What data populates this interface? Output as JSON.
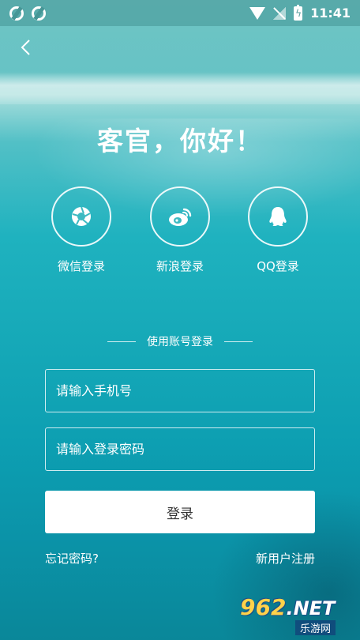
{
  "status_bar": {
    "time": "11:41",
    "left_icons": [
      "app-icon",
      "app-icon"
    ],
    "right_icons": [
      "wifi-icon",
      "no-signal-icon",
      "battery-charging-icon"
    ]
  },
  "header": {
    "back_icon": "chevron-left-icon"
  },
  "greeting": "客官，你好！",
  "social_logins": [
    {
      "label": "微信登录",
      "icon": "wechat-shutter-icon"
    },
    {
      "label": "新浪登录",
      "icon": "weibo-icon"
    },
    {
      "label": "QQ登录",
      "icon": "qq-penguin-icon"
    }
  ],
  "divider_text": "使用账号登录",
  "form": {
    "phone_placeholder": "请输入手机号",
    "password_placeholder": "请输入登录密码",
    "login_label": "登录",
    "forgot_label": "忘记密码?",
    "register_label": "新用户注册"
  },
  "watermark": {
    "number": "962",
    "domain": ".NET",
    "sub": "乐游网"
  },
  "colors": {
    "water_top": "#67c3c5",
    "water_bottom": "#0a8799",
    "button_bg": "#ffffff",
    "button_text": "#333333"
  }
}
